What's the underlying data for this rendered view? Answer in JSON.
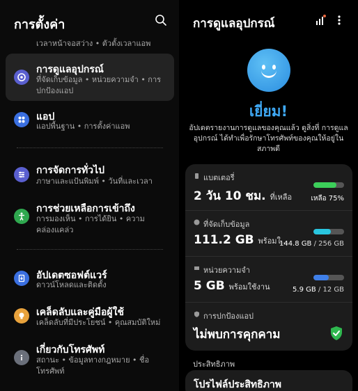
{
  "settings": {
    "title": "การตั้งค่า",
    "top_partial_subtitle": "เวลาหน้าจอสว่าง • ตัวตั้งเวลาแอพ",
    "items": [
      {
        "title": "การดูแลอุปกรณ์",
        "subtitle": "ที่จัดเก็บข้อมูล • หน่วยความจำ • การปกป้องแอป",
        "icon": "device-care-icon",
        "color": "#5a5fcf"
      },
      {
        "title": "แอป",
        "subtitle": "แอปพื้นฐาน • การตั้งค่าแอพ",
        "icon": "apps-icon",
        "color": "#3a6fe0"
      },
      {
        "title": "การจัดการทั่วไป",
        "subtitle": "ภาษาและแป้นพิมพ์ • วันที่และเวลา",
        "icon": "sliders-icon",
        "color": "#5a5fcf"
      },
      {
        "title": "การช่วยเหลือการเข้าถึง",
        "subtitle": "การมองเห็น • การได้ยิน • ความคล่องแคล่ว",
        "icon": "accessibility-icon",
        "color": "#2fa84f"
      },
      {
        "title": "อัปเดตซอฟต์แวร์",
        "subtitle": "ดาวน์โหลดและติดตั้ง",
        "icon": "software-update-icon",
        "color": "#3a6fe0"
      },
      {
        "title": "เคล็ดลับและคู่มือผู้ใช้",
        "subtitle": "เคล็ดลับที่มีประโยชน์ • คุณสมบัติใหม่",
        "icon": "lightbulb-icon",
        "color": "#e8a23c"
      },
      {
        "title": "เกี่ยวกับโทรศัพท์",
        "subtitle": "สถานะ • ข้อมูลทางกฎหมาย • ชื่อโทรศัพท์",
        "icon": "info-icon",
        "color": "#6a6f7a"
      }
    ]
  },
  "device_care": {
    "title": "การดูแลอุปกรณ์",
    "status": "เยี่ยม!",
    "description": "อัปเดตรายงานการดูแลของคุณแล้ว ดูสิ่งที่ การดูแลอุปกรณ์ ได้ทำเพื่อรักษาโทรศัพท์ของคุณให้อยู่ในสภาพดี",
    "battery": {
      "label": "แบตเตอรี่",
      "value": "2 วัน 10 ชม.",
      "suffix": "ที่เหลือ",
      "right_text": "เหลือ 75%",
      "level": 0.75,
      "color": "#3ccf5a"
    },
    "storage": {
      "label": "ที่จัดเก็บข้อมูล",
      "value": "111.2 GB",
      "suffix": "พร้อมใ...",
      "used": "144.8 GB",
      "total": " / 256 GB",
      "level": 0.57,
      "color": "#29c6e0"
    },
    "memory": {
      "label": "หน่วยความจำ",
      "value": "5 GB",
      "suffix": "พร้อมใช้งาน",
      "used": "5.9 GB",
      "total": " / 12 GB",
      "level": 0.49,
      "color": "#3f7fe8"
    },
    "app_protection": {
      "label": "การปกป้องแอป",
      "value": "ไม่พบการคุกคาม",
      "shield_color": "#2fb84f"
    },
    "performance_label": "ประสิทธิภาพ",
    "performance_profile": "โปรไฟล์ประสิทธิภาพ"
  }
}
